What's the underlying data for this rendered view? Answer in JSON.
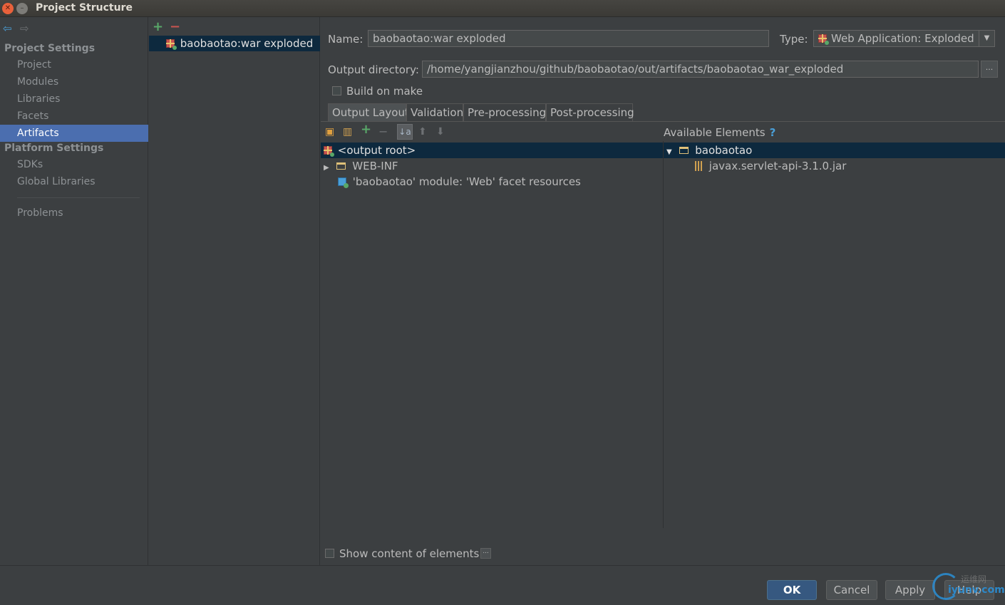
{
  "window": {
    "title": "Project Structure",
    "close_glyph": "✕",
    "min_glyph": "–"
  },
  "nav": {
    "back_glyph": "⇦",
    "forward_glyph": "⇨"
  },
  "sidebar": {
    "project_settings_header": "Project Settings",
    "project_items": [
      {
        "label": "Project",
        "selected": false
      },
      {
        "label": "Modules",
        "selected": false
      },
      {
        "label": "Libraries",
        "selected": false
      },
      {
        "label": "Facets",
        "selected": false
      },
      {
        "label": "Artifacts",
        "selected": true
      }
    ],
    "platform_settings_header": "Platform Settings",
    "platform_items": [
      {
        "label": "SDKs"
      },
      {
        "label": "Global Libraries"
      }
    ],
    "problems_label": "Problems"
  },
  "artifacts_list": {
    "add_glyph": "+",
    "remove_glyph": "−",
    "items": [
      {
        "label": "baobaotao:war exploded"
      }
    ]
  },
  "form": {
    "name_label": "Name:",
    "name_value": "baobaotao:war exploded",
    "type_label": "Type:",
    "type_value": "Web Application: Exploded",
    "type_arrow_glyph": "▼",
    "output_dir_label": "Output directory:",
    "output_dir_value": "/home/yangjianzhou/github/baobaotao/out/artifacts/baobaotao_war_exploded",
    "browse_glyph": "...",
    "build_on_make_label": "Build on make",
    "build_on_make_checked": false
  },
  "tabs": [
    {
      "label": "Output Layout",
      "active": true
    },
    {
      "label": "Validation",
      "active": false
    },
    {
      "label": "Pre-processing",
      "active": false
    },
    {
      "label": "Post-processing",
      "active": false
    }
  ],
  "layout_toolbar": {
    "new_dir_glyph": "▣",
    "jar_glyph": "▥",
    "add_glyph": "+",
    "remove_glyph": "−",
    "sort_glyph": "↓a",
    "up_glyph": "⬆",
    "down_glyph": "⬇"
  },
  "output_tree": [
    {
      "label": "<output root>",
      "icon": "gift-icon",
      "selected": true
    },
    {
      "label": "WEB-INF",
      "icon": "folder-icon",
      "expander": "▶"
    },
    {
      "label": "'baobaotao' module: 'Web' facet resources",
      "icon": "module-icon"
    }
  ],
  "available": {
    "header": "Available Elements",
    "help_glyph": "?",
    "tree": [
      {
        "label": "baobaotao",
        "icon": "folder-icon",
        "expander": "▼",
        "selected": true
      },
      {
        "label": "javax.servlet-api-3.1.0.jar",
        "icon": "jar-icon"
      }
    ]
  },
  "show_content": {
    "label": "Show content of elements",
    "checked": false,
    "more_glyph": "..."
  },
  "buttons": {
    "ok": "OK",
    "cancel": "Cancel",
    "apply": "Apply",
    "help": "Help"
  },
  "watermark": {
    "text": "iyunv.com",
    "cn": "运维网"
  },
  "colors": {
    "selection": "#4b6eaf",
    "tree_selection": "#0d293e",
    "background": "#3c3f41",
    "accent_blue": "#4a9fd8"
  }
}
